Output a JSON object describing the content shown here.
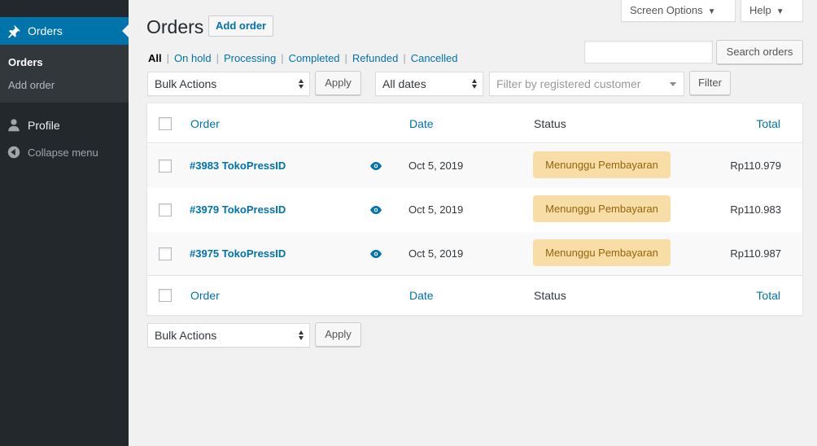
{
  "sidebar": {
    "active_menu": "Orders",
    "submenu": [
      "Orders",
      "Add order"
    ],
    "profile": "Profile",
    "collapse": "Collapse menu"
  },
  "header": {
    "title": "Orders",
    "add_button": "Add order",
    "screen_options": "Screen Options",
    "help": "Help"
  },
  "filters": {
    "views": [
      "All",
      "On hold",
      "Processing",
      "Completed",
      "Refunded",
      "Cancelled"
    ],
    "search_button": "Search orders",
    "search_value": "",
    "bulk_actions": "Bulk Actions",
    "apply": "Apply",
    "dates": "All dates",
    "customer_placeholder": "Filter by registered customer",
    "filter_button": "Filter"
  },
  "table": {
    "columns": {
      "order": "Order",
      "date": "Date",
      "status": "Status",
      "total": "Total"
    },
    "rows": [
      {
        "order": "#3983 TokoPressID",
        "date": "Oct 5, 2019",
        "status": "Menunggu Pembayaran",
        "total": "Rp110.979"
      },
      {
        "order": "#3979 TokoPressID",
        "date": "Oct 5, 2019",
        "status": "Menunggu Pembayaran",
        "total": "Rp110.983"
      },
      {
        "order": "#3975 TokoPressID",
        "date": "Oct 5, 2019",
        "status": "Menunggu Pembayaran",
        "total": "Rp110.987"
      }
    ]
  },
  "bottom": {
    "bulk_actions": "Bulk Actions",
    "apply": "Apply"
  },
  "colors": {
    "accent": "#0073aa",
    "sidebar": "#23282d",
    "status_bg": "#f8dda7",
    "status_text": "#94660c"
  },
  "icons": {
    "orders": "pin-icon",
    "profile": "user-icon",
    "collapse": "collapse-icon",
    "preview": "eye-icon"
  }
}
